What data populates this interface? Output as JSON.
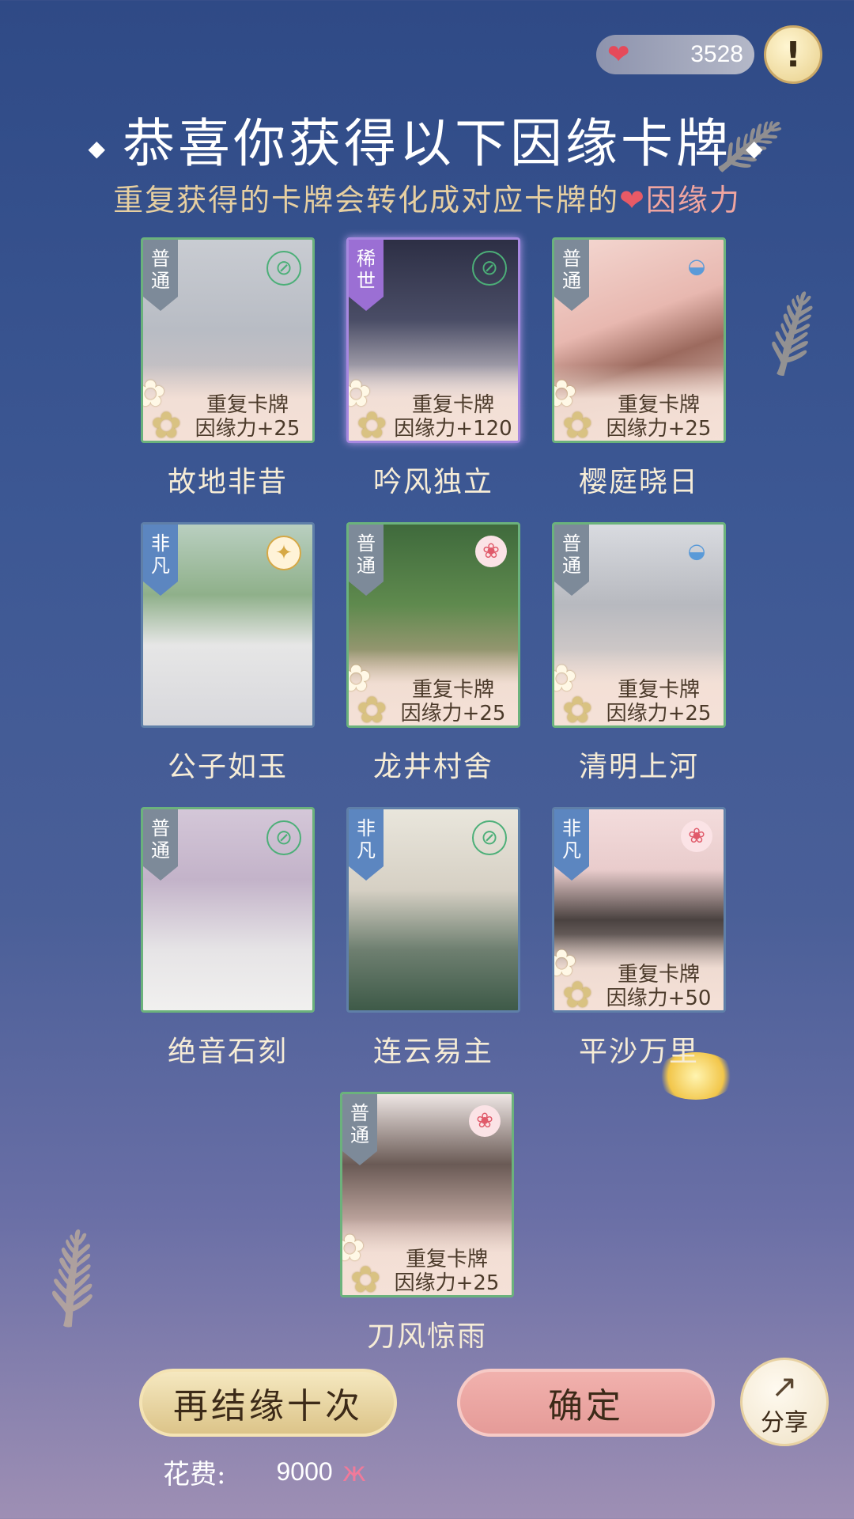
{
  "counter": {
    "icon": "hearts-icon",
    "value": "3528"
  },
  "info_button": {
    "label": "!"
  },
  "title": "恭喜你获得以下因缘卡牌",
  "subtitle": {
    "prefix": "重复获得的卡牌会转化成对应卡牌的",
    "accent": "因缘力"
  },
  "cards": [
    {
      "rank": "普通",
      "name": "故地非昔",
      "dup": true,
      "dup_title": "重复卡牌",
      "dup_power": "因缘力+25"
    },
    {
      "rank": "稀世",
      "name": "吟风独立",
      "dup": true,
      "dup_title": "重复卡牌",
      "dup_power": "因缘力+120"
    },
    {
      "rank": "普通",
      "name": "樱庭晓日",
      "dup": true,
      "dup_title": "重复卡牌",
      "dup_power": "因缘力+25"
    },
    {
      "rank": "非凡",
      "name": "公子如玉",
      "dup": false
    },
    {
      "rank": "普通",
      "name": "龙井村舍",
      "dup": true,
      "dup_title": "重复卡牌",
      "dup_power": "因缘力+25"
    },
    {
      "rank": "普通",
      "name": "清明上河",
      "dup": true,
      "dup_title": "重复卡牌",
      "dup_power": "因缘力+25"
    },
    {
      "rank": "普通",
      "name": "绝音石刻",
      "dup": false
    },
    {
      "rank": "非凡",
      "name": "连云易主",
      "dup": false
    },
    {
      "rank": "非凡",
      "name": "平沙万里",
      "dup": true,
      "dup_title": "重复卡牌",
      "dup_power": "因缘力+50"
    },
    {
      "rank": "普通",
      "name": "刀风惊雨",
      "dup": true,
      "dup_title": "重复卡牌",
      "dup_power": "因缘力+25"
    }
  ],
  "buttons": {
    "again": "再结缘十次",
    "confirm": "确定",
    "share": "分享"
  },
  "cost": {
    "label": "花费:",
    "amount": "9000",
    "icon": "butterfly-icon"
  },
  "colors": {
    "background": "#3d5894",
    "title": "#ffffff",
    "subtitle": "#e6cfa1",
    "accent": "#e85a66",
    "common_border": "#6bb27c",
    "rare_border": "#a788e0"
  }
}
